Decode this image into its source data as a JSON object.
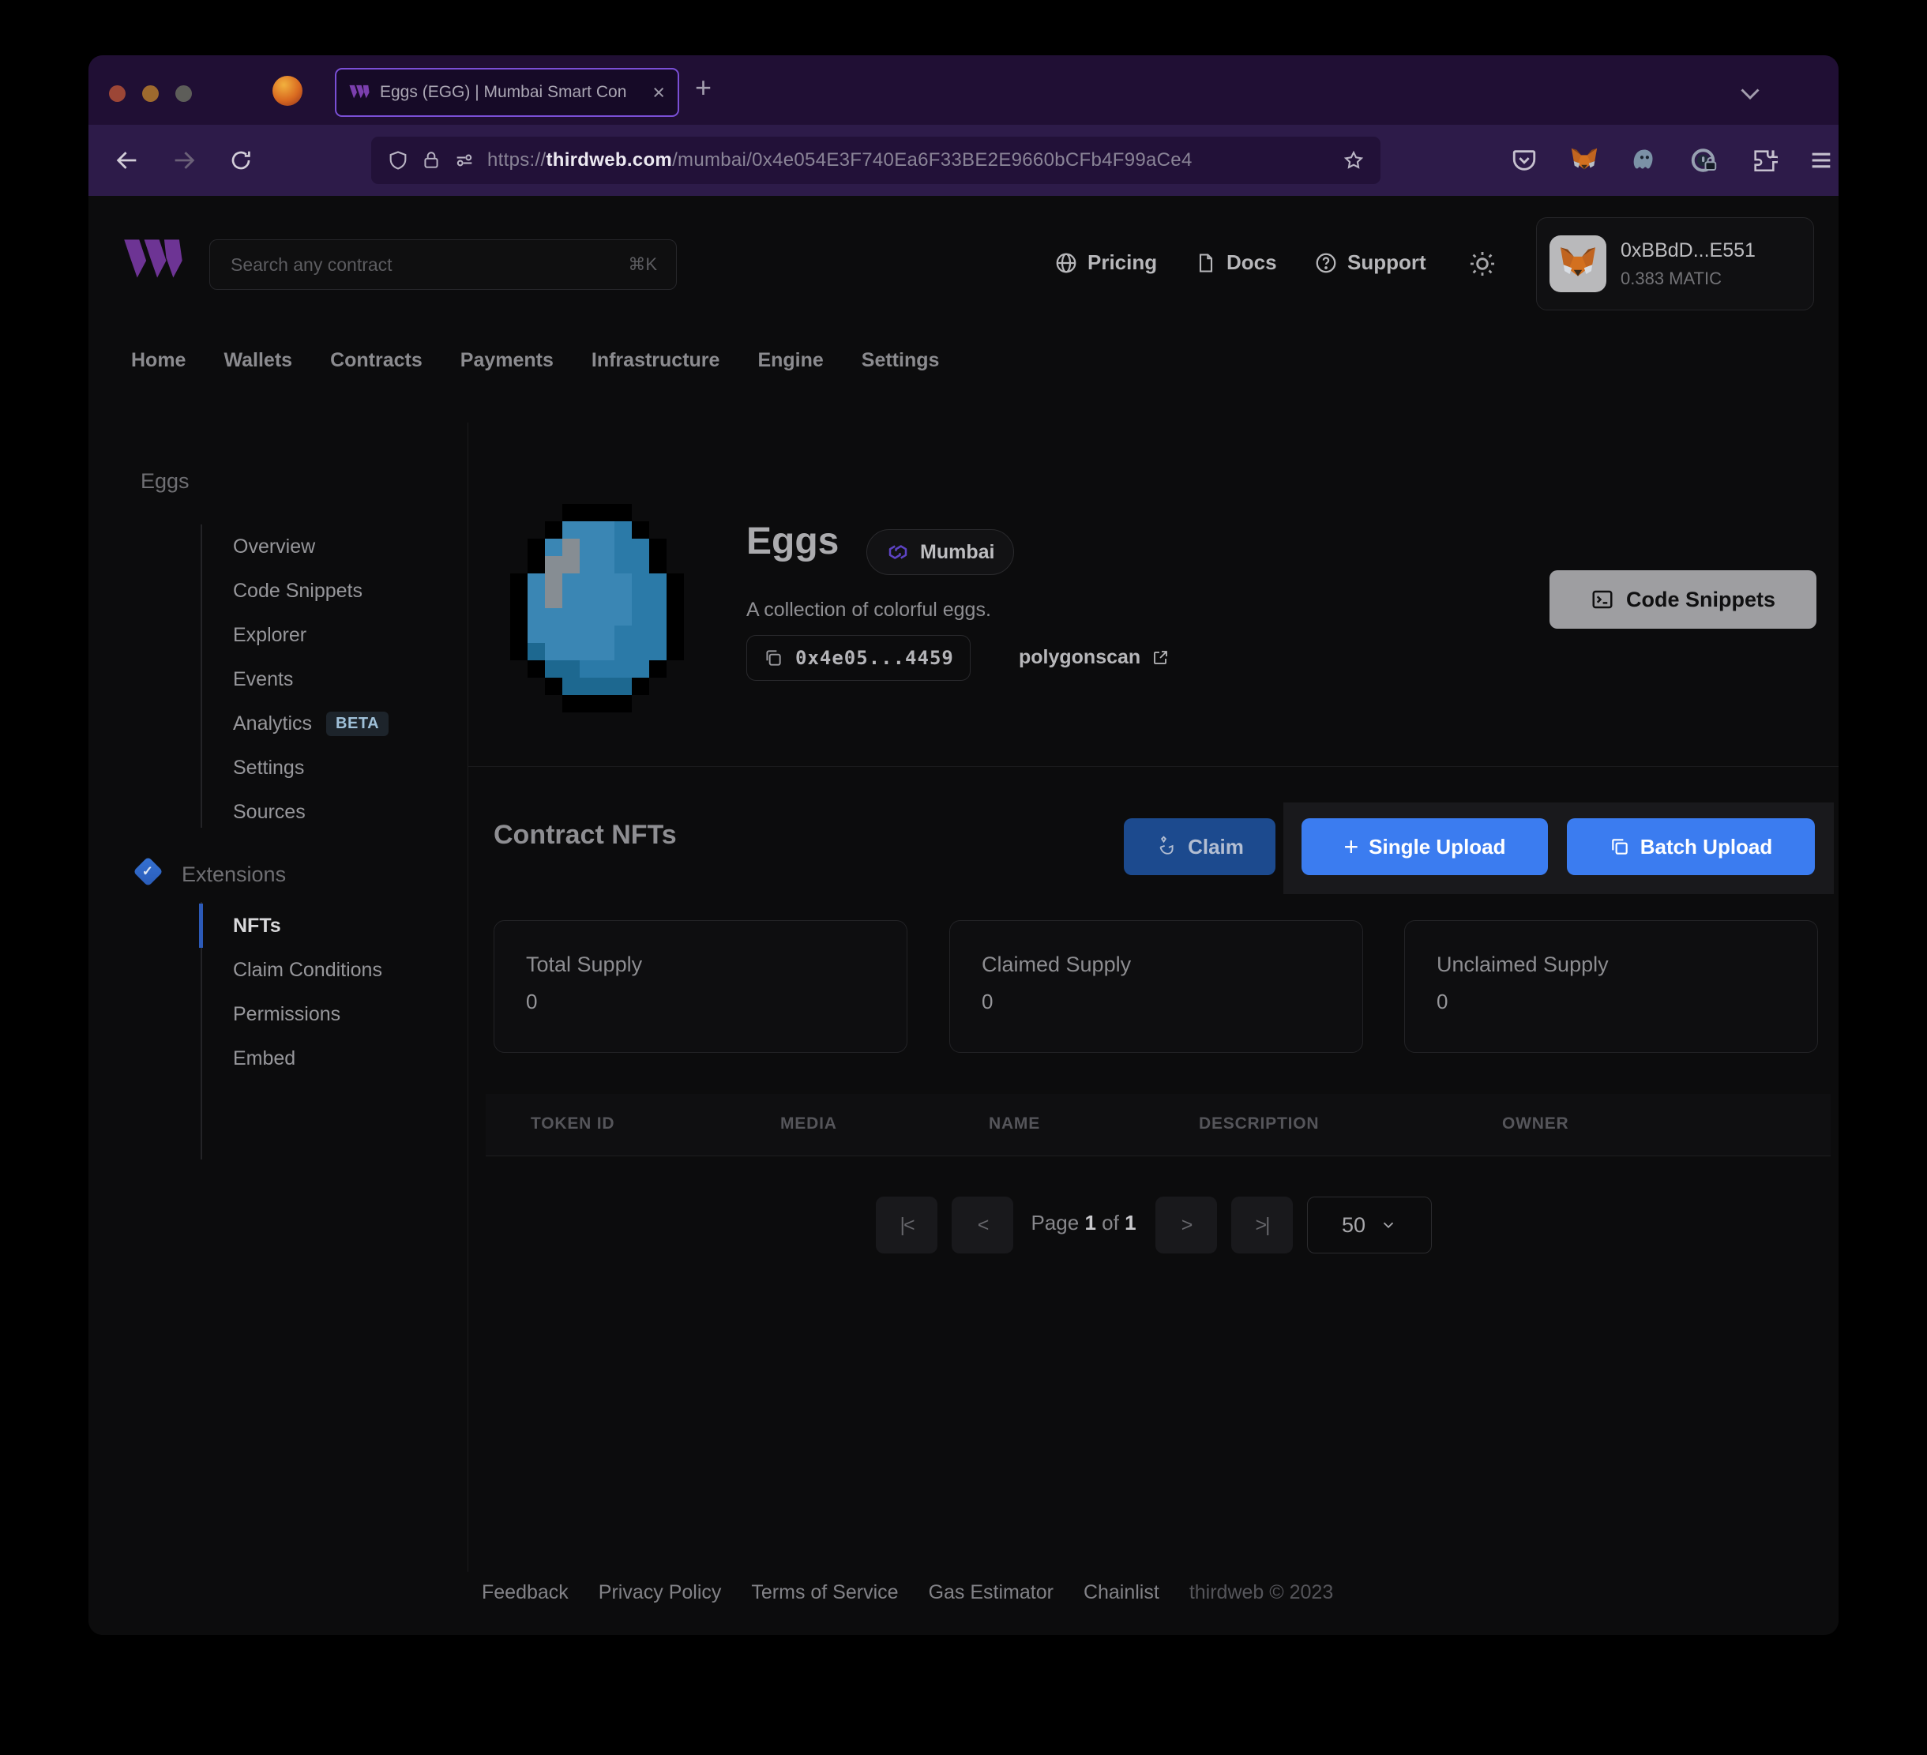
{
  "browser": {
    "tab_title": "Eggs (EGG) | Mumbai Smart Con",
    "close_glyph": "×",
    "new_tab_glyph": "+",
    "url_scheme": "https://",
    "url_domain": "thirdweb.com",
    "url_path": "/mumbai/0x4e054E3F740Ea6F33BE2E9660bCFb4F99aCe4"
  },
  "header": {
    "search_placeholder": "Search any contract",
    "search_shortcut": "⌘K",
    "links": [
      {
        "label": "Pricing"
      },
      {
        "label": "Docs"
      },
      {
        "label": "Support"
      }
    ],
    "support_glyph": "?",
    "wallet": {
      "address": "0xBBdD...E551",
      "balance": "0.383 MATIC"
    }
  },
  "nav": {
    "items": [
      "Home",
      "Wallets",
      "Contracts",
      "Payments",
      "Infrastructure",
      "Engine",
      "Settings"
    ]
  },
  "sidebar": {
    "project": "Eggs",
    "items": [
      "Overview",
      "Code Snippets",
      "Explorer",
      "Events",
      "Analytics",
      "Settings",
      "Sources"
    ],
    "beta_badge": "BETA",
    "extensions_label": "Extensions",
    "extensions_check": "✓",
    "extension_items": [
      "NFTs",
      "Claim Conditions",
      "Permissions",
      "Embed"
    ]
  },
  "contract": {
    "name": "Eggs",
    "network": "Mumbai",
    "description": "A collection of colorful eggs.",
    "address_short": "0x4e05...4459",
    "explorer_label": "polygonscan",
    "code_snippets_label": "Code Snippets"
  },
  "nft_section": {
    "heading": "Contract NFTs",
    "claim_label": "Claim",
    "single_upload_plus": "+",
    "single_upload_label": "Single Upload",
    "batch_upload_label": "Batch Upload",
    "stats": [
      {
        "label": "Total Supply",
        "value": "0"
      },
      {
        "label": "Claimed Supply",
        "value": "0"
      },
      {
        "label": "Unclaimed Supply",
        "value": "0"
      }
    ],
    "table_headers": [
      "TOKEN ID",
      "MEDIA",
      "NAME",
      "DESCRIPTION",
      "OWNER"
    ],
    "pagination": {
      "first": "|<",
      "prev": "<",
      "next": ">",
      "last": ">|",
      "label_page": "Page",
      "current": "1",
      "label_of": "of",
      "total": "1",
      "page_size": "50"
    }
  },
  "footer": {
    "links": [
      "Feedback",
      "Privacy Policy",
      "Terms of Service",
      "Gas Estimator",
      "Chainlist"
    ],
    "copyright": "thirdweb © 2023"
  }
}
